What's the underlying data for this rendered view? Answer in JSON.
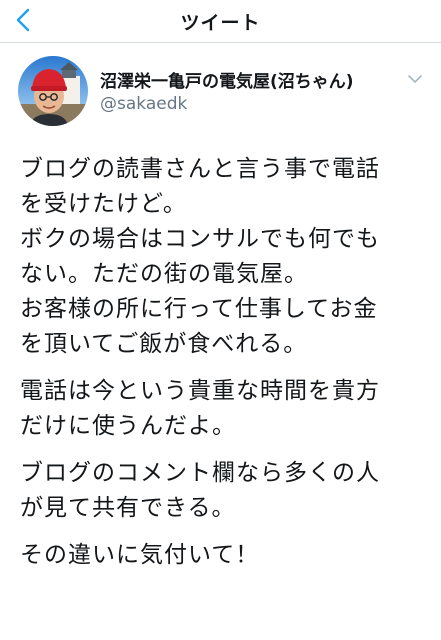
{
  "nav": {
    "back_icon": "chevron-left-icon",
    "title": "ツイート",
    "accent_color": "#1da1f2"
  },
  "author": {
    "display_name": "沼澤栄一亀戸の電気屋(沼ちゃん)",
    "handle": "@sakaedk",
    "more_icon": "chevron-down-icon"
  },
  "tweet": {
    "paragraphs": [
      {
        "lines": [
          "ブログの読書さんと言う事で電話",
          "を受けたけど。",
          "ボクの場合はコンサルでも何でも",
          "ない。ただの街の電気屋。",
          "お客様の所に行って仕事してお金",
          "を頂いてご飯が食べれる。"
        ]
      },
      {
        "lines": [
          "電話は今という貴重な時間を貴方",
          "だけに使うんだよ。"
        ]
      },
      {
        "lines": [
          "ブログのコメント欄なら多くの人",
          "が見て共有できる。"
        ]
      },
      {
        "lines": [
          "その違いに気付いて！"
        ]
      }
    ]
  }
}
